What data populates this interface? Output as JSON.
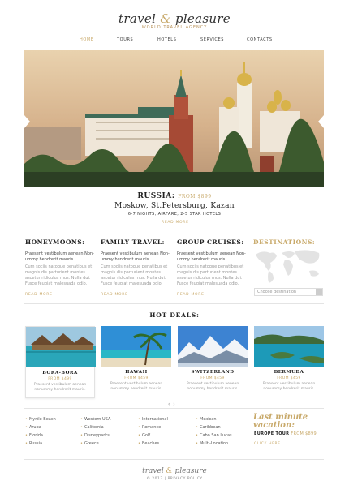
{
  "header": {
    "logo_left": "travel",
    "logo_amp": "&",
    "logo_right": "pleasure",
    "tagline": "WORLD TRAVEL AGENCY"
  },
  "nav": {
    "items": [
      "HOME",
      "TOURS",
      "HOTELS",
      "SERVICES",
      "CONTACTS"
    ],
    "active": "HOME"
  },
  "slider": {
    "image": "moscow-kremlin-photo",
    "title": "RUSSIA:",
    "from_label": "FROM $899",
    "cities": "Moskow, St.Petersburg, Kazan",
    "details": "6-7 NIGHTS, AIRFARE, 2-5 STAR HOTELS",
    "read_more": "READ MORE"
  },
  "columns": [
    {
      "title": "HONEYMOONS:",
      "lead": "Praesent vestibulum aenean Non-ummy hendrerit mauris.",
      "body": "Cum sociis natoque penatibus et magnis dis parturient montes ascetur ridiculus mus. Nulla dui. Fusce feugiat malesuada odio.",
      "read_more": "READ MORE"
    },
    {
      "title": "FAMILY TRAVEL:",
      "lead": "Praesent vestibulum aenean Non-ummy hendrerit mauris.",
      "body": "Cum sociis natoque penatibus et magnis dis parturient montes ascetur ridiculus mus. Nulla dui. Fusce feugiat malesuada odio.",
      "read_more": "READ MORE"
    },
    {
      "title": "GROUP CRUISES:",
      "lead": "Praesent vestibulum aenean Non-ummy hendrerit mauris.",
      "body": "Cum sociis natoque penatibus et magnis dis parturient montes ascetur ridiculus mus. Nulla dui. Fusce feugiat malesuada odio.",
      "read_more": "READ MORE"
    }
  ],
  "destinations": {
    "title": "DESTINATIONS:",
    "search_placeholder": "Choose destination"
  },
  "hot_deals": {
    "title": "HOT DEALS:",
    "items": [
      {
        "name": "BORA-BORA",
        "price": "FROM $499",
        "desc": "Praesent vestibulum aenean nonummy hendrerit mauris."
      },
      {
        "name": "HAWAII",
        "price": "FROM $459",
        "desc": "Praesent vestibulum aenean nonummy hendrerit mauris."
      },
      {
        "name": "SWITZERLAND",
        "price": "FROM $459",
        "desc": "Praesent vestibulum aenean nonummy hendrerit mauris."
      },
      {
        "name": "BERMUDA",
        "price": "FROM $459",
        "desc": "Praesent vestibulum aenean nonummy hendrerit mauris."
      }
    ]
  },
  "footer_links": [
    [
      "Myrtle Beach",
      "Aruba",
      "Florida",
      "Russia"
    ],
    [
      "Western USA",
      "California",
      "Disneyparks",
      "Greece"
    ],
    [
      "International",
      "Romance",
      "Golf",
      "Beaches"
    ],
    [
      "Mexican",
      "Caribbean",
      "Cabo San Lucas",
      "Multi-Location"
    ]
  ],
  "last_minute": {
    "title_line1": "Last minute",
    "title_line2": "vacation:",
    "subtitle": "EUROPE TOUR",
    "from": "FROM $899",
    "click": "CLICK HERE"
  },
  "footer": {
    "logo_left": "travel",
    "logo_amp": "&",
    "logo_right": "pleasure",
    "copyright": "© 2013 | PRIVACY POLICY"
  },
  "colors": {
    "accent": "#c8a96a",
    "text": "#222222",
    "muted": "#999999"
  }
}
